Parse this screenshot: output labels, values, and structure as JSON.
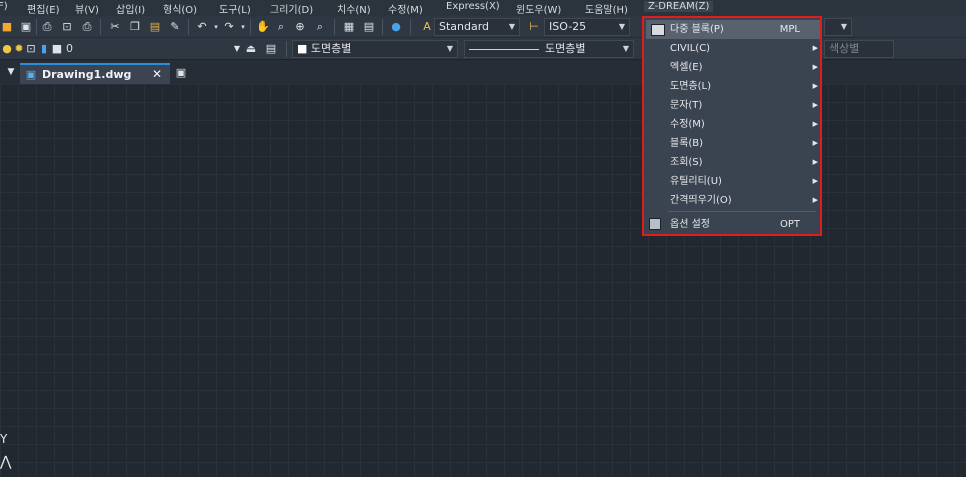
{
  "menubar": {
    "items": [
      "편집(E)",
      "뷰(V)",
      "삽입(I)",
      "형식(O)",
      "도구(L)",
      "그리기(D)",
      "치수(N)",
      "수정(M)",
      "Express(X)",
      "윈도우(W)",
      "도움말(H)",
      "Z-DREAM(Z)"
    ]
  },
  "toolbar": {
    "text_style": "Standard",
    "dim_style": "ISO-25",
    "layer_value": "0",
    "color_value": "도면층별",
    "linetype_value": "도면층별",
    "lineweight_value": "색상별"
  },
  "tabs": {
    "document": "Drawing1.dwg",
    "close_symbol": "✕"
  },
  "canvas": {
    "ucs_y": "Y"
  },
  "dropdown": {
    "items": [
      {
        "label": "다중 블록(P)",
        "shortcut": "MPL",
        "submenu": false
      },
      {
        "label": "CIVIL(C)",
        "shortcut": "",
        "submenu": true
      },
      {
        "label": "엑셀(E)",
        "shortcut": "",
        "submenu": true
      },
      {
        "label": "도면층(L)",
        "shortcut": "",
        "submenu": true
      },
      {
        "label": "문자(T)",
        "shortcut": "",
        "submenu": true
      },
      {
        "label": "수정(M)",
        "shortcut": "",
        "submenu": true
      },
      {
        "label": "블록(B)",
        "shortcut": "",
        "submenu": true
      },
      {
        "label": "조회(S)",
        "shortcut": "",
        "submenu": true
      },
      {
        "label": "유틸리티(U)",
        "shortcut": "",
        "submenu": true
      },
      {
        "label": "간격띄우기(O)",
        "shortcut": "",
        "submenu": true
      },
      {
        "label": "옵션 설정",
        "shortcut": "OPT",
        "submenu": false
      }
    ],
    "highlight_color": "#e01c1c"
  }
}
